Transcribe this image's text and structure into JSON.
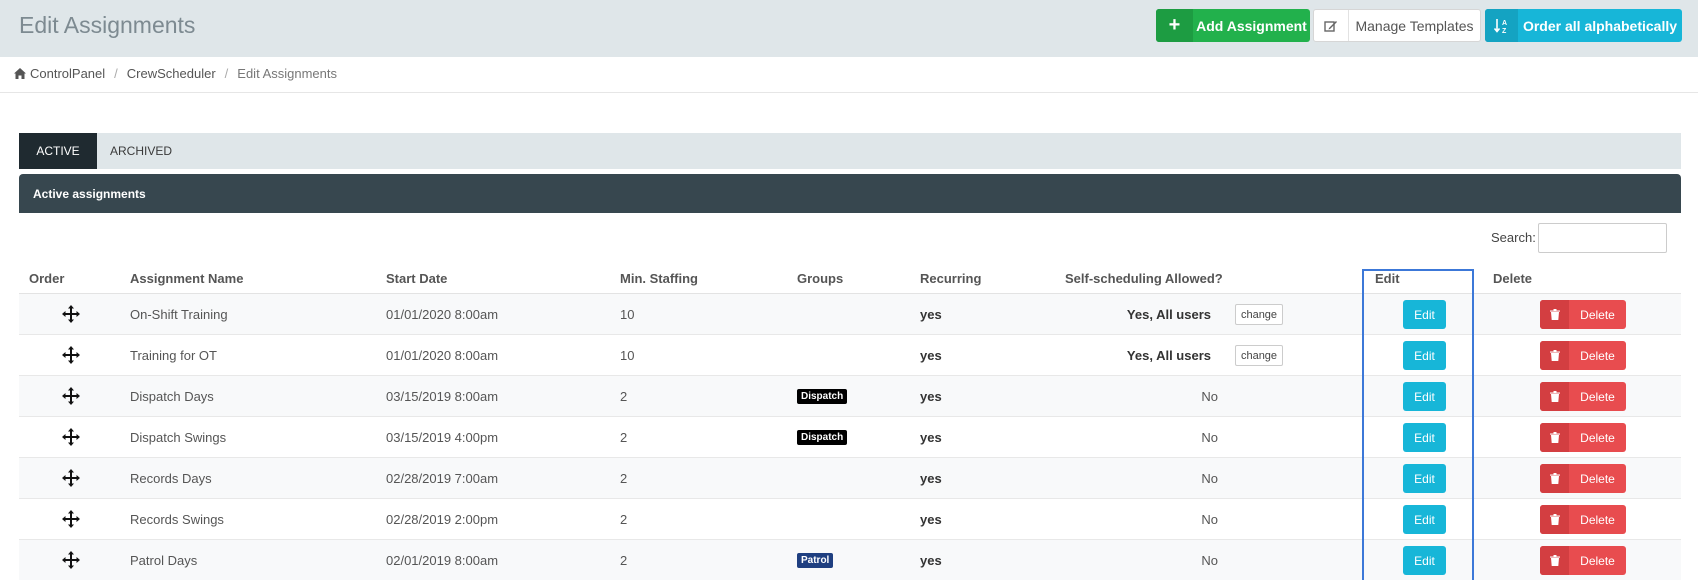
{
  "header": {
    "title": "Edit Assignments",
    "add_label": "Add Assignment",
    "templates_label": "Manage Templates",
    "order_label": "Order all alphabetically"
  },
  "breadcrumb": {
    "items": [
      "ControlPanel",
      "CrewScheduler",
      "Edit Assignments"
    ]
  },
  "tabs": [
    "ACTIVE",
    "ARCHIVED"
  ],
  "panel": {
    "title": "Active assignments"
  },
  "search": {
    "label": "Search:",
    "placeholder": ""
  },
  "columns": [
    "Order",
    "Assignment Name",
    "Start Date",
    "Min. Staffing",
    "Groups",
    "Recurring",
    "Self-scheduling Allowed?",
    "Edit",
    "Delete"
  ],
  "rows": [
    {
      "name": "On-Shift Training",
      "start": "01/01/2020 8:00am",
      "min": "10",
      "group": "",
      "recurring": "yes",
      "self": "Yes, All users",
      "change": "change"
    },
    {
      "name": "Training for OT",
      "start": "01/01/2020 8:00am",
      "min": "10",
      "group": "",
      "recurring": "yes",
      "self": "Yes, All users",
      "change": "change"
    },
    {
      "name": "Dispatch Days",
      "start": "03/15/2019 8:00am",
      "min": "2",
      "group": "Dispatch",
      "recurring": "yes",
      "self": "No",
      "change": ""
    },
    {
      "name": "Dispatch Swings",
      "start": "03/15/2019 4:00pm",
      "min": "2",
      "group": "Dispatch",
      "recurring": "yes",
      "self": "No",
      "change": ""
    },
    {
      "name": "Records Days",
      "start": "02/28/2019 7:00am",
      "min": "2",
      "group": "",
      "recurring": "yes",
      "self": "No",
      "change": ""
    },
    {
      "name": "Records Swings",
      "start": "02/28/2019 2:00pm",
      "min": "2",
      "group": "",
      "recurring": "yes",
      "self": "No",
      "change": ""
    },
    {
      "name": "Patrol Days",
      "start": "02/01/2019 8:00am",
      "min": "2",
      "group": "Patrol",
      "recurring": "yes",
      "self": "No",
      "change": ""
    }
  ],
  "buttons": {
    "edit": "Edit",
    "delete": "Delete"
  },
  "colors": {
    "add": "#22b14c",
    "order": "#17b6d8",
    "edit": "#17b6d8",
    "delete": "#e84c4f",
    "dispatch_badge": "#000000",
    "patrol_badge": "#1f3f80",
    "highlight": "#3c78d8"
  },
  "icons": {
    "add": "plus-icon",
    "templates": "pencil-square-icon",
    "order": "sort-alpha-icon",
    "home": "home-icon",
    "drag": "move-arrows-icon",
    "delete": "trash-icon"
  }
}
